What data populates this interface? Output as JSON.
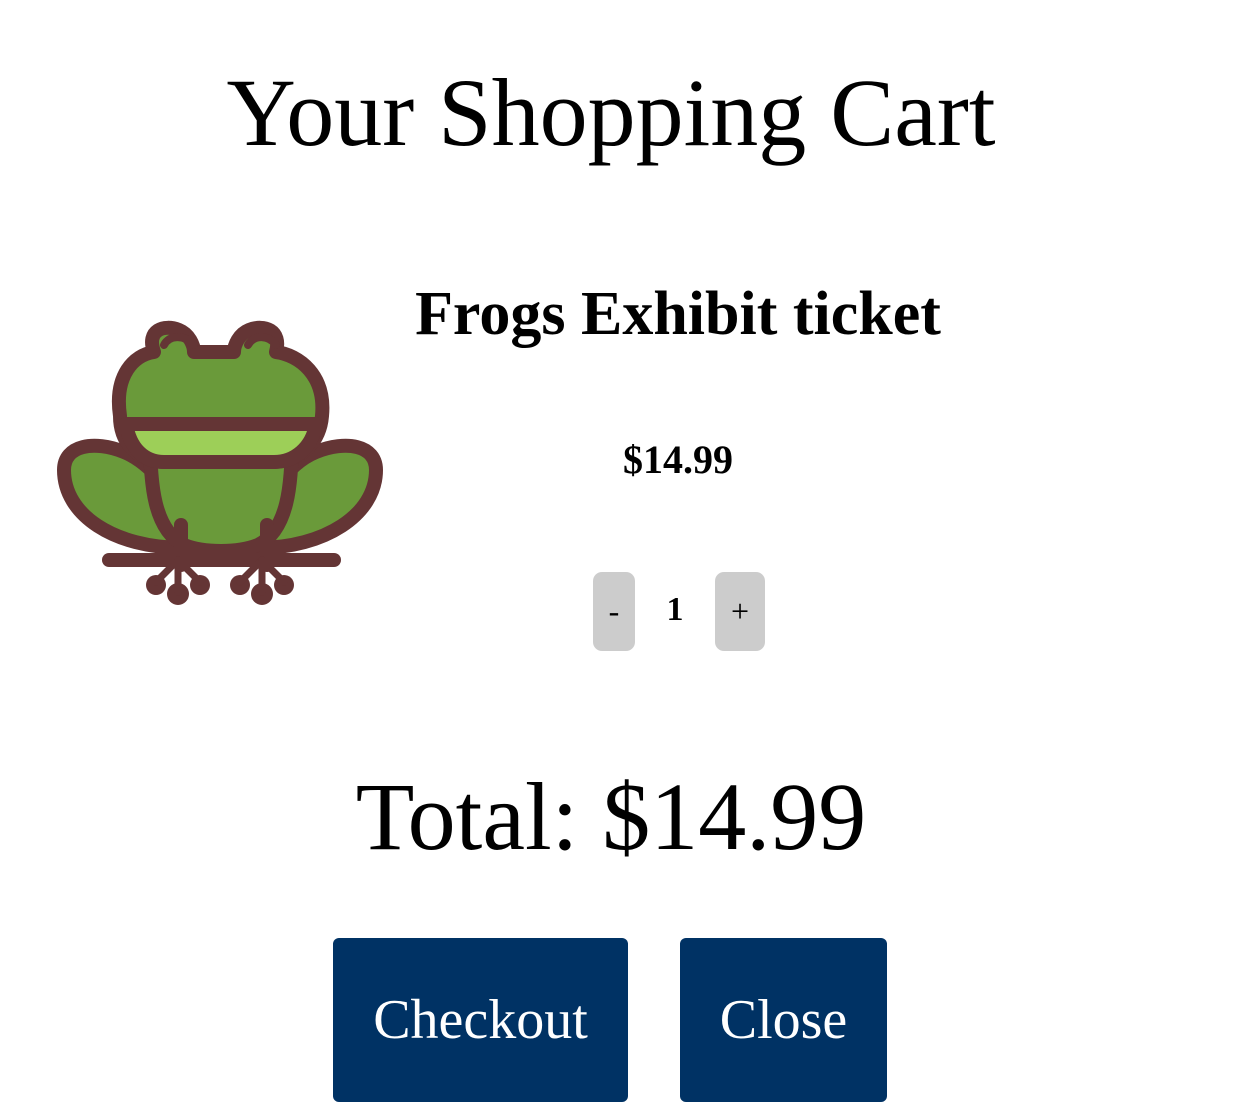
{
  "cart": {
    "title": "Your Shopping Cart",
    "total_label": "Total: $14.99"
  },
  "item": {
    "name": "Frogs Exhibit ticket",
    "price": "$14.99",
    "quantity": "1",
    "image_icon": "frog-icon",
    "minus_label": "-",
    "plus_label": "+"
  },
  "actions": {
    "checkout_label": "Checkout",
    "close_label": "Close"
  },
  "colors": {
    "button_primary": "#003264",
    "button_quantity": "#cccccc",
    "frog_outline": "#643535",
    "frog_body": "#6a9a3a",
    "frog_stripe": "#9dcf58"
  }
}
